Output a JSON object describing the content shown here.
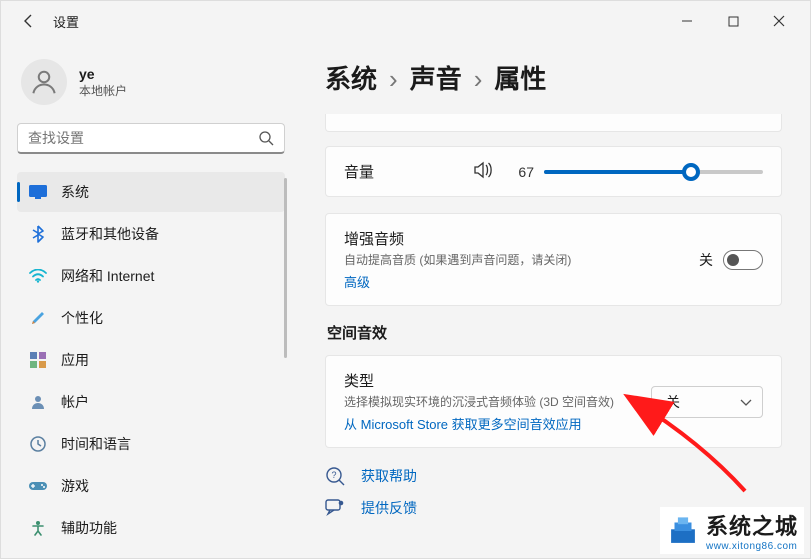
{
  "app": {
    "title": "设置"
  },
  "account": {
    "name": "ye",
    "subtitle": "本地帐户"
  },
  "search": {
    "placeholder": "查找设置"
  },
  "sidebar": {
    "items": [
      {
        "id": "system",
        "label": "系统"
      },
      {
        "id": "bluetooth",
        "label": "蓝牙和其他设备"
      },
      {
        "id": "network",
        "label": "网络和 Internet"
      },
      {
        "id": "personalize",
        "label": "个性化"
      },
      {
        "id": "apps",
        "label": "应用"
      },
      {
        "id": "accounts",
        "label": "帐户"
      },
      {
        "id": "time",
        "label": "时间和语言"
      },
      {
        "id": "gaming",
        "label": "游戏"
      },
      {
        "id": "access",
        "label": "辅助功能"
      }
    ],
    "active": "system"
  },
  "breadcrumb": {
    "p0": "系统",
    "p1": "声音",
    "p2": "属性"
  },
  "volume": {
    "label": "音量",
    "value": 67
  },
  "enhance": {
    "title": "增强音频",
    "subtitle": "自动提高音质 (如果遇到声音问题，请关闭)",
    "link": "高级",
    "toggle_label": "关",
    "toggle_on": false
  },
  "spatial": {
    "section": "空间音效",
    "title": "类型",
    "subtitle": "选择模拟现实环境的沉浸式音频体验 (3D 空间音效)",
    "link": "从 Microsoft Store 获取更多空间音效应用",
    "dropdown_value": "关"
  },
  "footer": {
    "help": "获取帮助",
    "feedback": "提供反馈"
  },
  "watermark": {
    "text": "系统之城",
    "url": "www.xitong86.com"
  },
  "colors": {
    "accent": "#0067c0"
  }
}
